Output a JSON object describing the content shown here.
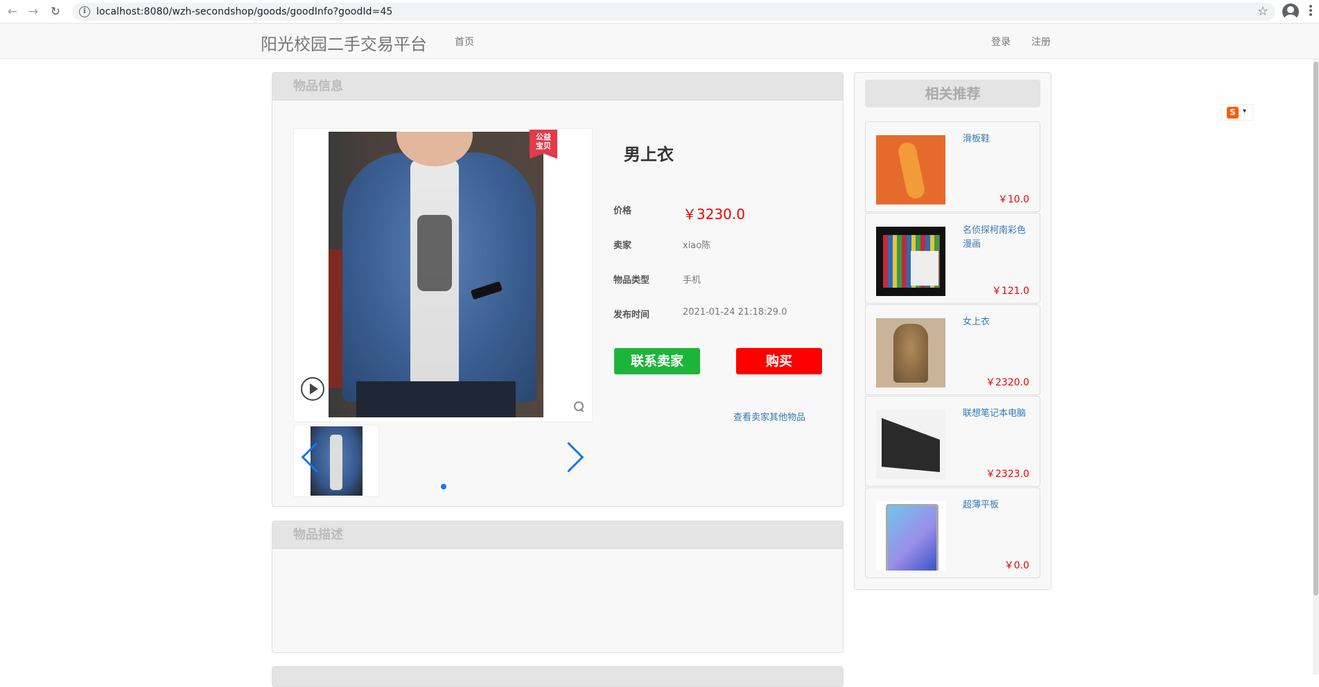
{
  "browser": {
    "url": "localhost:8080/wzh-secondshop/goods/goodInfo?goodId=45"
  },
  "navbar": {
    "brand": "阳光校园二手交易平台",
    "home": "首页",
    "login": "登录",
    "register": "注册"
  },
  "info_panel": {
    "heading": "物品信息",
    "badge": "公益\n宝贝",
    "title": "男上衣",
    "price_label": "价格",
    "price": "￥3230.0",
    "seller_label": "卖家",
    "seller": "xiao陈",
    "type_label": "物品类型",
    "type": "手机",
    "time_label": "发布时间",
    "time": "2021-01-24 21:18:29.0",
    "contact_button": "联系卖家",
    "buy_button": "购买",
    "more_link": "查看卖家其他物品"
  },
  "desc_panel": {
    "heading": "物品描述"
  },
  "recommend": {
    "heading": "相关推荐",
    "items": [
      {
        "name": "滑板鞋",
        "price": "￥10.0",
        "image": "skateboard"
      },
      {
        "name": "名侦探柯南彩色漫画",
        "price": "￥121.0",
        "image": "comic-books"
      },
      {
        "name": "女上衣",
        "price": "￥2320.0",
        "image": "coat"
      },
      {
        "name": "联想笔记本电脑",
        "price": "￥2323.0",
        "image": "laptop"
      },
      {
        "name": "超薄平板",
        "price": "￥0.0",
        "image": "tablet"
      }
    ]
  },
  "colors": {
    "price": "#e00000",
    "contact_button": "#1db539",
    "buy_button": "#ff0000",
    "link": "#337ab7",
    "carousel_accent": "#1677e5"
  }
}
